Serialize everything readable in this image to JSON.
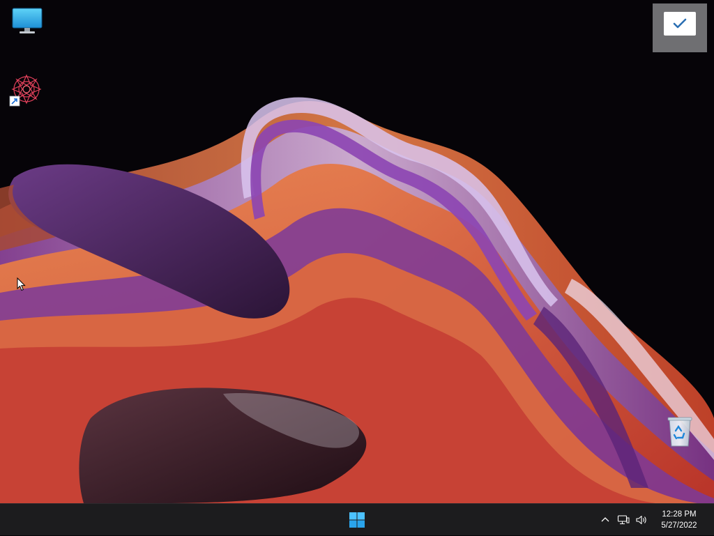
{
  "desktop": {
    "icons": [
      {
        "name": "this-pc",
        "icon": "monitor-icon"
      },
      {
        "name": "app-shortcut",
        "icon": "mandala-shortcut-icon"
      },
      {
        "name": "recycle-bin",
        "icon": "recycle-bin-icon"
      }
    ],
    "notification": {
      "icon": "checkmark-icon"
    }
  },
  "taskbar": {
    "start_icon": "windows-logo-icon",
    "tray": {
      "icons": [
        "chevron-up-icon",
        "network-icon",
        "volume-icon"
      ]
    },
    "clock": {
      "time": "12:28 PM",
      "date": "5/27/2022"
    }
  },
  "colors": {
    "taskbar_bg": "#1c1c1e",
    "windows_blue": "#4cc2ff",
    "wallpaper_purple": "#5a2d6e",
    "wallpaper_orange": "#e0622a"
  }
}
